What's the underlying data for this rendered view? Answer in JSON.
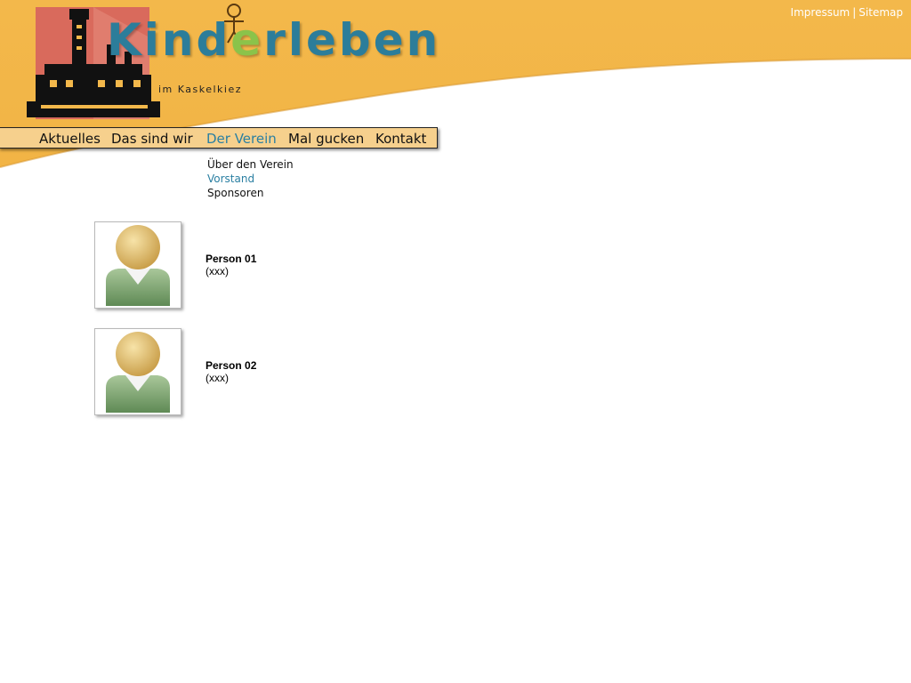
{
  "site": {
    "logo_title": "Kinderleben",
    "logo_subtitle": "im Kaskelkiez"
  },
  "top_links": {
    "impressum": "Impressum",
    "separator": "|",
    "sitemap": "Sitemap"
  },
  "main_nav": {
    "items": [
      {
        "label": "Aktuelles"
      },
      {
        "label": "Das sind wir"
      },
      {
        "label": "Der Verein",
        "active": true
      },
      {
        "label": "Mal gucken"
      },
      {
        "label": "Kontakt"
      }
    ]
  },
  "sub_nav": {
    "items": [
      {
        "label": "Über den Verein"
      },
      {
        "label": "Vorstand",
        "active": true
      },
      {
        "label": "Sponsoren"
      }
    ]
  },
  "people": [
    {
      "name": "Person 01",
      "role": "(xxx)",
      "icon": "person-avatar-icon"
    },
    {
      "name": "Person 02",
      "role": "(xxx)",
      "icon": "person-avatar-icon"
    }
  ],
  "colors": {
    "header_orange": "#f3b84b",
    "nav_bar": "#f6d08d",
    "active_link": "#2a7fa2",
    "logo_letters": "#2c7d9a"
  }
}
